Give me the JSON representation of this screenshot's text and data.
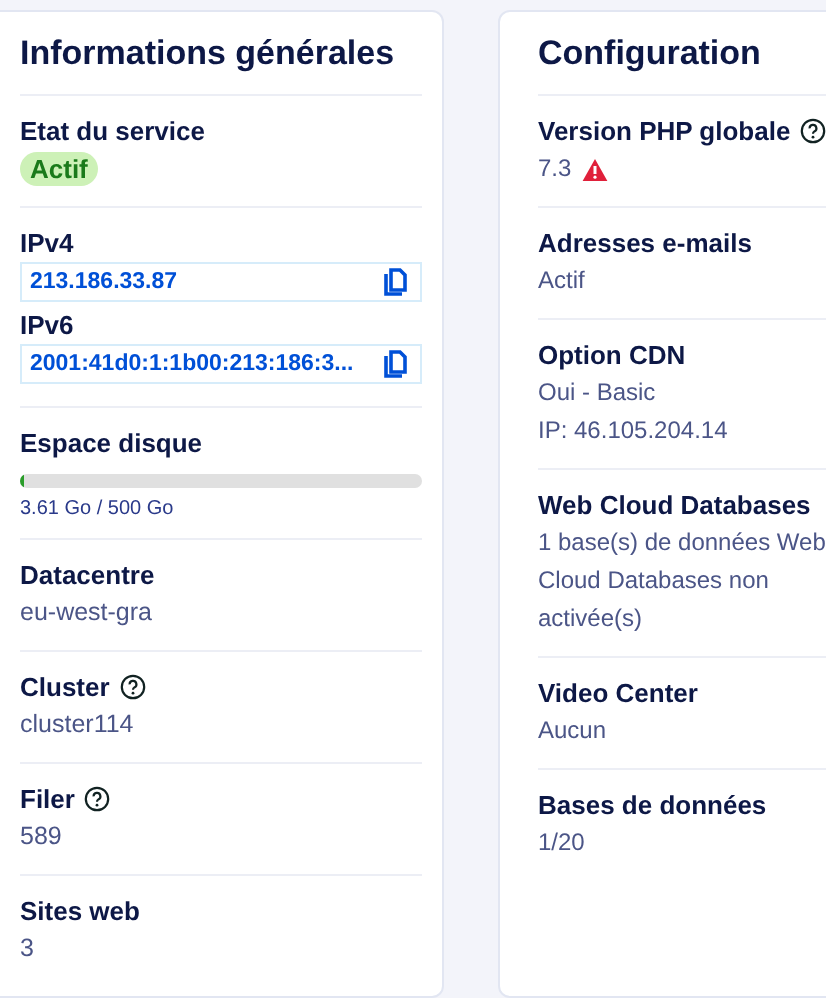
{
  "panels": [
    {
      "title": "Informations générales",
      "items": [
        {
          "kind": "status",
          "label": "Etat du service",
          "badge": "Actif"
        },
        {
          "kind": "copy",
          "fields": [
            {
              "label": "IPv4",
              "value": "213.186.33.87"
            },
            {
              "label": "IPv6",
              "value": "2001:41d0:1:1b00:213:186:3..."
            }
          ]
        },
        {
          "kind": "meter",
          "label": "Espace disque",
          "level": 0.01,
          "reading": "3.61 Go / 500 Go"
        },
        {
          "kind": "text",
          "label": "Datacentre",
          "help": false,
          "lines": [
            "eu-west-gra"
          ]
        },
        {
          "kind": "text",
          "label": "Cluster",
          "help": true,
          "lines": [
            "cluster114"
          ]
        },
        {
          "kind": "text",
          "label": "Filer",
          "help": true,
          "lines": [
            "589"
          ]
        },
        {
          "kind": "text",
          "label": "Sites web",
          "help": false,
          "lines": [
            "3"
          ]
        }
      ]
    },
    {
      "title": "Configuration",
      "items": [
        {
          "kind": "text",
          "label": "Version PHP globale",
          "help": true,
          "warning": true,
          "lines": [
            "7.3"
          ]
        },
        {
          "kind": "text",
          "label": "Adresses e-mails",
          "help": false,
          "lines": [
            "Actif"
          ]
        },
        {
          "kind": "text",
          "label": "Option CDN",
          "help": false,
          "lines": [
            "Oui - Basic",
            "IP: 46.105.204.14"
          ]
        },
        {
          "kind": "text",
          "label": "Web Cloud Databases",
          "help": false,
          "lines": [
            "1 base(s) de données Web Cloud Databases non activée(s)"
          ]
        },
        {
          "kind": "text",
          "label": "Video Center",
          "help": false,
          "lines": [
            "Aucun"
          ]
        },
        {
          "kind": "text",
          "label": "Bases de données",
          "help": false,
          "lines": [
            "1/20"
          ]
        }
      ]
    }
  ]
}
